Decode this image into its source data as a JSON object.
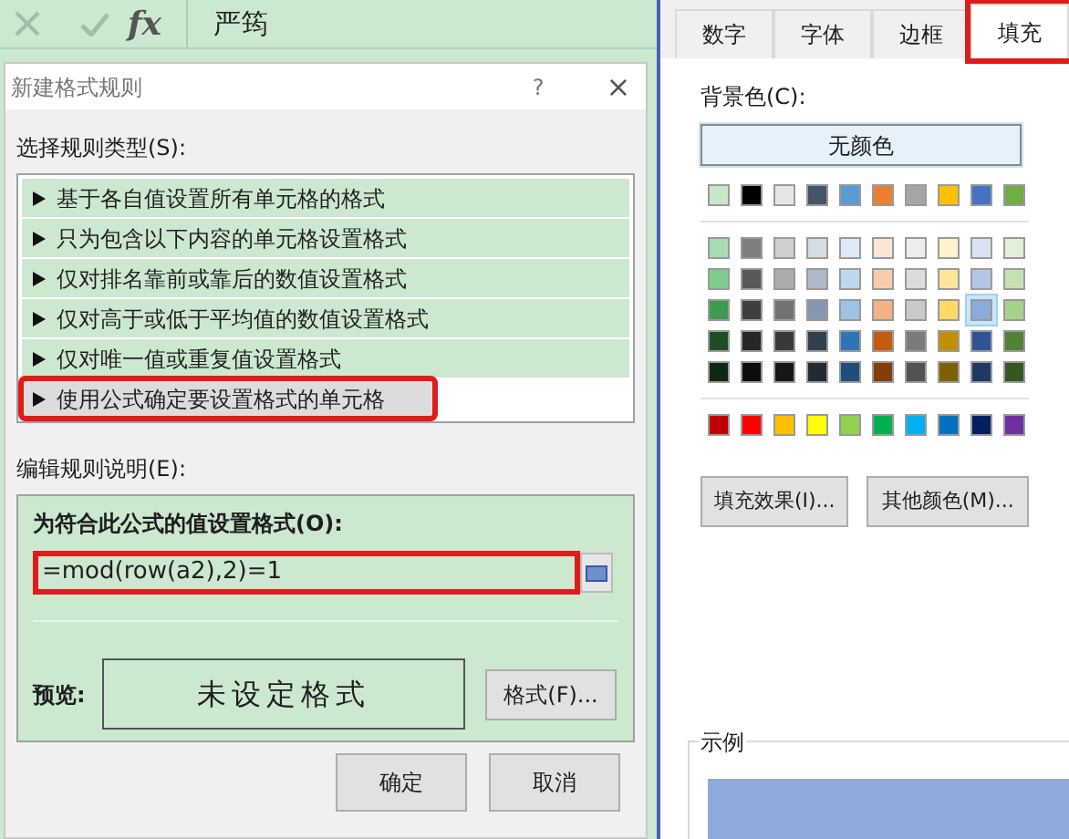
{
  "formula_bar": {
    "fx": "fx",
    "value": "严筠"
  },
  "dialog": {
    "title": "新建格式规则",
    "help": "?",
    "close": "×",
    "rule_type_label": "选择规则类型(S):",
    "rule_types": [
      {
        "label": "基于各自值设置所有单元格的格式",
        "selected": false,
        "highlighted": false
      },
      {
        "label": "只为包含以下内容的单元格设置格式",
        "selected": false,
        "highlighted": false
      },
      {
        "label": "仅对排名靠前或靠后的数值设置格式",
        "selected": false,
        "highlighted": false
      },
      {
        "label": "仅对高于或低于平均值的数值设置格式",
        "selected": false,
        "highlighted": false
      },
      {
        "label": "仅对唯一值或重复值设置格式",
        "selected": false,
        "highlighted": false
      },
      {
        "label": "使用公式确定要设置格式的单元格",
        "selected": true,
        "highlighted": true
      }
    ],
    "edit_label": "编辑规则说明(E):",
    "formula_label": "为符合此公式的值设置格式(O):",
    "formula": {
      "value": "=mod(row(a2),2)=1",
      "highlighted": true
    },
    "preview_label": "预览:",
    "preview_text": "未设定格式",
    "format_button": "格式(F)...",
    "buttons": [
      "确定",
      "取消"
    ]
  },
  "format_panel": {
    "tabs": [
      {
        "label": "数字",
        "selected": false,
        "highlighted": false
      },
      {
        "label": "字体",
        "selected": false,
        "highlighted": false
      },
      {
        "label": "边框",
        "selected": false,
        "highlighted": false
      },
      {
        "label": "填充",
        "selected": true,
        "highlighted": true
      }
    ],
    "background_label": "背景色(C):",
    "no_color_button": "无颜色",
    "theme_row": [
      {
        "color": "#c6e7cb",
        "selected": false
      },
      {
        "color": "#000000",
        "selected": false
      },
      {
        "color": "#e7e6e6",
        "selected": false
      },
      {
        "color": "#44546a",
        "selected": false
      },
      {
        "color": "#5b9bd5",
        "selected": false
      },
      {
        "color": "#ed7d31",
        "selected": false
      },
      {
        "color": "#a5a5a5",
        "selected": false
      },
      {
        "color": "#ffc000",
        "selected": false
      },
      {
        "color": "#4472c4",
        "selected": false
      },
      {
        "color": "#70ad47",
        "selected": false
      }
    ],
    "shade_rows": [
      {
        "swatches": [
          {
            "color": "#a9dbb4",
            "selected": false
          },
          {
            "color": "#7f7f7f",
            "selected": false
          },
          {
            "color": "#d0cece",
            "selected": false
          },
          {
            "color": "#d6dce4",
            "selected": false
          },
          {
            "color": "#deebf6",
            "selected": false
          },
          {
            "color": "#fbe5d5",
            "selected": false
          },
          {
            "color": "#ededed",
            "selected": false
          },
          {
            "color": "#fff2cc",
            "selected": false
          },
          {
            "color": "#d9e2f3",
            "selected": false
          },
          {
            "color": "#e2efd9",
            "selected": false
          }
        ]
      },
      {
        "swatches": [
          {
            "color": "#7dcb8d",
            "selected": false
          },
          {
            "color": "#595959",
            "selected": false
          },
          {
            "color": "#aeaaaa",
            "selected": false
          },
          {
            "color": "#adb9ca",
            "selected": false
          },
          {
            "color": "#bdd7ee",
            "selected": false
          },
          {
            "color": "#f8cbad",
            "selected": false
          },
          {
            "color": "#dbdbdb",
            "selected": false
          },
          {
            "color": "#ffe599",
            "selected": false
          },
          {
            "color": "#b4c6e7",
            "selected": false
          },
          {
            "color": "#c5e0b3",
            "selected": false
          }
        ]
      },
      {
        "swatches": [
          {
            "color": "#3f9a50",
            "selected": false
          },
          {
            "color": "#3f3f3f",
            "selected": false
          },
          {
            "color": "#757171",
            "selected": false
          },
          {
            "color": "#8496b0",
            "selected": false
          },
          {
            "color": "#9cc3e5",
            "selected": false
          },
          {
            "color": "#f4b183",
            "selected": false
          },
          {
            "color": "#c9c9c9",
            "selected": false
          },
          {
            "color": "#ffd966",
            "selected": false
          },
          {
            "color": "#8eaadb",
            "selected": true
          },
          {
            "color": "#a8d08d",
            "selected": false
          }
        ]
      },
      {
        "swatches": [
          {
            "color": "#1f4e26",
            "selected": false
          },
          {
            "color": "#262626",
            "selected": false
          },
          {
            "color": "#3a3838",
            "selected": false
          },
          {
            "color": "#323f4f",
            "selected": false
          },
          {
            "color": "#2e75b5",
            "selected": false
          },
          {
            "color": "#c55a11",
            "selected": false
          },
          {
            "color": "#7b7b7b",
            "selected": false
          },
          {
            "color": "#bf9000",
            "selected": false
          },
          {
            "color": "#2f5496",
            "selected": false
          },
          {
            "color": "#538135",
            "selected": false
          }
        ]
      },
      {
        "swatches": [
          {
            "color": "#0f2713",
            "selected": false
          },
          {
            "color": "#0c0c0c",
            "selected": false
          },
          {
            "color": "#171616",
            "selected": false
          },
          {
            "color": "#222a35",
            "selected": false
          },
          {
            "color": "#1e4e79",
            "selected": false
          },
          {
            "color": "#843c0b",
            "selected": false
          },
          {
            "color": "#525252",
            "selected": false
          },
          {
            "color": "#7f6000",
            "selected": false
          },
          {
            "color": "#1f3864",
            "selected": false
          },
          {
            "color": "#375623",
            "selected": false
          }
        ]
      }
    ],
    "standard_row": [
      {
        "color": "#c00000",
        "selected": false
      },
      {
        "color": "#ff0000",
        "selected": false
      },
      {
        "color": "#ffc000",
        "selected": false
      },
      {
        "color": "#ffff00",
        "selected": false
      },
      {
        "color": "#92d050",
        "selected": false
      },
      {
        "color": "#00b050",
        "selected": false
      },
      {
        "color": "#00b0f0",
        "selected": false
      },
      {
        "color": "#0070c0",
        "selected": false
      },
      {
        "color": "#002060",
        "selected": false
      },
      {
        "color": "#7030a0",
        "selected": false
      }
    ],
    "fill_effects_button": "填充效果(I)...",
    "more_colors_button": "其他颜色(M)...",
    "sample": {
      "label": "示例",
      "color": "#8eaadb"
    }
  }
}
